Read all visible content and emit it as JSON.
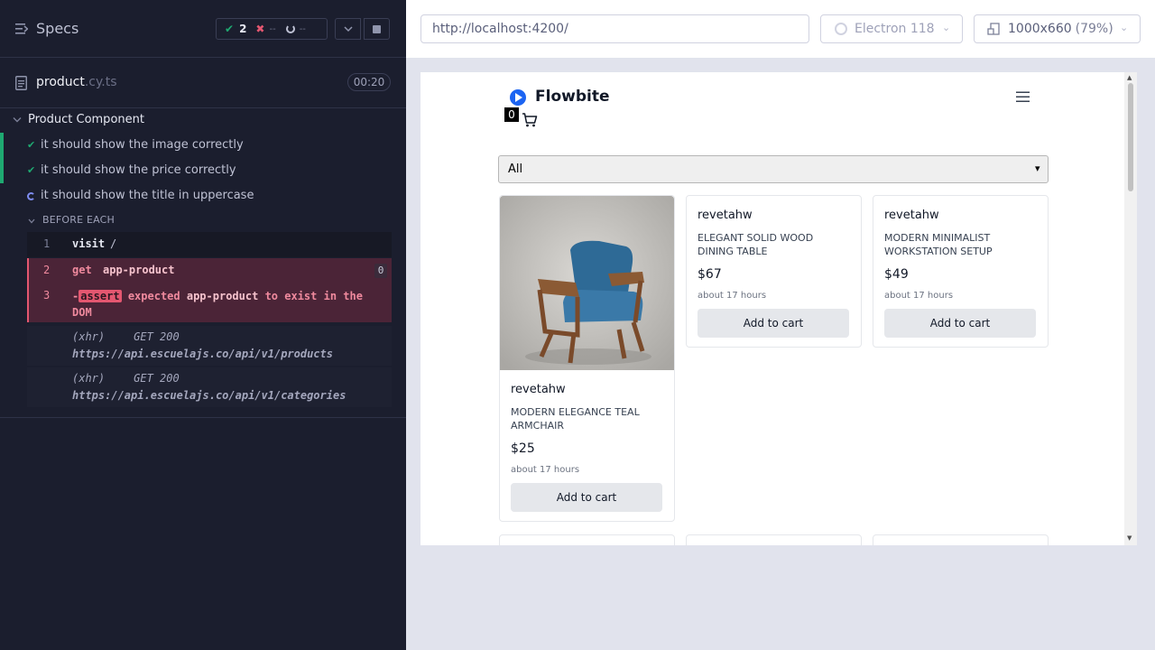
{
  "reporter": {
    "title": "Specs",
    "stats": {
      "passed": "2",
      "failed": "--",
      "pending": "--"
    },
    "file": {
      "name": "product",
      "ext": ".cy.ts",
      "duration": "00:20"
    },
    "suite": "Product Component",
    "tests": [
      {
        "label": "it should show the image correctly",
        "state": "passed"
      },
      {
        "label": "it should show the price correctly",
        "state": "passed"
      },
      {
        "label": "it should show the title in uppercase",
        "state": "running"
      }
    ],
    "hook_label": "BEFORE EACH",
    "commands": [
      {
        "num": "1",
        "name": "visit",
        "arg": "/"
      },
      {
        "num": "2",
        "name": "get",
        "arg": "app-product",
        "count": "0"
      },
      {
        "num": "3",
        "prefix": "-",
        "badge": "assert",
        "text_1": "expected",
        "arg": "app-product",
        "text_2": "to exist in the DOM"
      }
    ],
    "xhr": [
      {
        "type": "(xhr)",
        "method": "GET 200",
        "url": "https://api.escuelajs.co/api/v1/products"
      },
      {
        "type": "(xhr)",
        "method": "GET 200",
        "url": "https://api.escuelajs.co/api/v1/categories"
      }
    ]
  },
  "runner": {
    "url": "http://localhost:4200/",
    "browser": "Electron 118",
    "viewport": "1000x660",
    "zoom": "(79%)"
  },
  "app": {
    "brand": "Flowbite",
    "cart_count": "0",
    "category_select": "All",
    "products": [
      {
        "author": "revetahw",
        "title": "Modern Elegance Teal Armchair",
        "price": "$25",
        "time": "about 17 hours",
        "button": "Add to cart",
        "has_image": true
      },
      {
        "author": "revetahw",
        "title": "Elegant Solid Wood Dining Table",
        "price": "$67",
        "time": "about 17 hours",
        "button": "Add to cart",
        "has_image": false
      },
      {
        "author": "revetahw",
        "title": "Modern Minimalist Workstation Setup",
        "price": "$49",
        "time": "about 17 hours",
        "button": "Add to cart",
        "has_image": false
      }
    ]
  },
  "colors": {
    "pass": "#1fa971",
    "fail": "#e45770",
    "brand": "#1c64f2",
    "reporter_bg": "#1b1e2e"
  }
}
